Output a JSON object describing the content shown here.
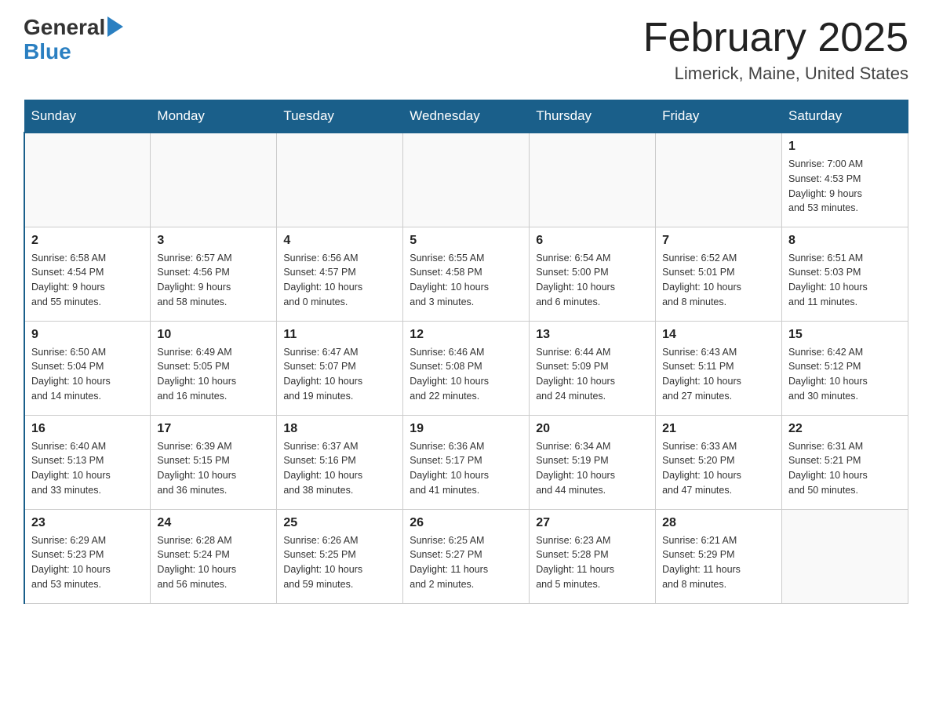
{
  "logo": {
    "general": "General",
    "blue": "Blue",
    "arrow": "▶"
  },
  "title": "February 2025",
  "location": "Limerick, Maine, United States",
  "days_of_week": [
    "Sunday",
    "Monday",
    "Tuesday",
    "Wednesday",
    "Thursday",
    "Friday",
    "Saturday"
  ],
  "weeks": [
    [
      {
        "day": "",
        "info": ""
      },
      {
        "day": "",
        "info": ""
      },
      {
        "day": "",
        "info": ""
      },
      {
        "day": "",
        "info": ""
      },
      {
        "day": "",
        "info": ""
      },
      {
        "day": "",
        "info": ""
      },
      {
        "day": "1",
        "info": "Sunrise: 7:00 AM\nSunset: 4:53 PM\nDaylight: 9 hours\nand 53 minutes."
      }
    ],
    [
      {
        "day": "2",
        "info": "Sunrise: 6:58 AM\nSunset: 4:54 PM\nDaylight: 9 hours\nand 55 minutes."
      },
      {
        "day": "3",
        "info": "Sunrise: 6:57 AM\nSunset: 4:56 PM\nDaylight: 9 hours\nand 58 minutes."
      },
      {
        "day": "4",
        "info": "Sunrise: 6:56 AM\nSunset: 4:57 PM\nDaylight: 10 hours\nand 0 minutes."
      },
      {
        "day": "5",
        "info": "Sunrise: 6:55 AM\nSunset: 4:58 PM\nDaylight: 10 hours\nand 3 minutes."
      },
      {
        "day": "6",
        "info": "Sunrise: 6:54 AM\nSunset: 5:00 PM\nDaylight: 10 hours\nand 6 minutes."
      },
      {
        "day": "7",
        "info": "Sunrise: 6:52 AM\nSunset: 5:01 PM\nDaylight: 10 hours\nand 8 minutes."
      },
      {
        "day": "8",
        "info": "Sunrise: 6:51 AM\nSunset: 5:03 PM\nDaylight: 10 hours\nand 11 minutes."
      }
    ],
    [
      {
        "day": "9",
        "info": "Sunrise: 6:50 AM\nSunset: 5:04 PM\nDaylight: 10 hours\nand 14 minutes."
      },
      {
        "day": "10",
        "info": "Sunrise: 6:49 AM\nSunset: 5:05 PM\nDaylight: 10 hours\nand 16 minutes."
      },
      {
        "day": "11",
        "info": "Sunrise: 6:47 AM\nSunset: 5:07 PM\nDaylight: 10 hours\nand 19 minutes."
      },
      {
        "day": "12",
        "info": "Sunrise: 6:46 AM\nSunset: 5:08 PM\nDaylight: 10 hours\nand 22 minutes."
      },
      {
        "day": "13",
        "info": "Sunrise: 6:44 AM\nSunset: 5:09 PM\nDaylight: 10 hours\nand 24 minutes."
      },
      {
        "day": "14",
        "info": "Sunrise: 6:43 AM\nSunset: 5:11 PM\nDaylight: 10 hours\nand 27 minutes."
      },
      {
        "day": "15",
        "info": "Sunrise: 6:42 AM\nSunset: 5:12 PM\nDaylight: 10 hours\nand 30 minutes."
      }
    ],
    [
      {
        "day": "16",
        "info": "Sunrise: 6:40 AM\nSunset: 5:13 PM\nDaylight: 10 hours\nand 33 minutes."
      },
      {
        "day": "17",
        "info": "Sunrise: 6:39 AM\nSunset: 5:15 PM\nDaylight: 10 hours\nand 36 minutes."
      },
      {
        "day": "18",
        "info": "Sunrise: 6:37 AM\nSunset: 5:16 PM\nDaylight: 10 hours\nand 38 minutes."
      },
      {
        "day": "19",
        "info": "Sunrise: 6:36 AM\nSunset: 5:17 PM\nDaylight: 10 hours\nand 41 minutes."
      },
      {
        "day": "20",
        "info": "Sunrise: 6:34 AM\nSunset: 5:19 PM\nDaylight: 10 hours\nand 44 minutes."
      },
      {
        "day": "21",
        "info": "Sunrise: 6:33 AM\nSunset: 5:20 PM\nDaylight: 10 hours\nand 47 minutes."
      },
      {
        "day": "22",
        "info": "Sunrise: 6:31 AM\nSunset: 5:21 PM\nDaylight: 10 hours\nand 50 minutes."
      }
    ],
    [
      {
        "day": "23",
        "info": "Sunrise: 6:29 AM\nSunset: 5:23 PM\nDaylight: 10 hours\nand 53 minutes."
      },
      {
        "day": "24",
        "info": "Sunrise: 6:28 AM\nSunset: 5:24 PM\nDaylight: 10 hours\nand 56 minutes."
      },
      {
        "day": "25",
        "info": "Sunrise: 6:26 AM\nSunset: 5:25 PM\nDaylight: 10 hours\nand 59 minutes."
      },
      {
        "day": "26",
        "info": "Sunrise: 6:25 AM\nSunset: 5:27 PM\nDaylight: 11 hours\nand 2 minutes."
      },
      {
        "day": "27",
        "info": "Sunrise: 6:23 AM\nSunset: 5:28 PM\nDaylight: 11 hours\nand 5 minutes."
      },
      {
        "day": "28",
        "info": "Sunrise: 6:21 AM\nSunset: 5:29 PM\nDaylight: 11 hours\nand 8 minutes."
      },
      {
        "day": "",
        "info": ""
      }
    ]
  ]
}
